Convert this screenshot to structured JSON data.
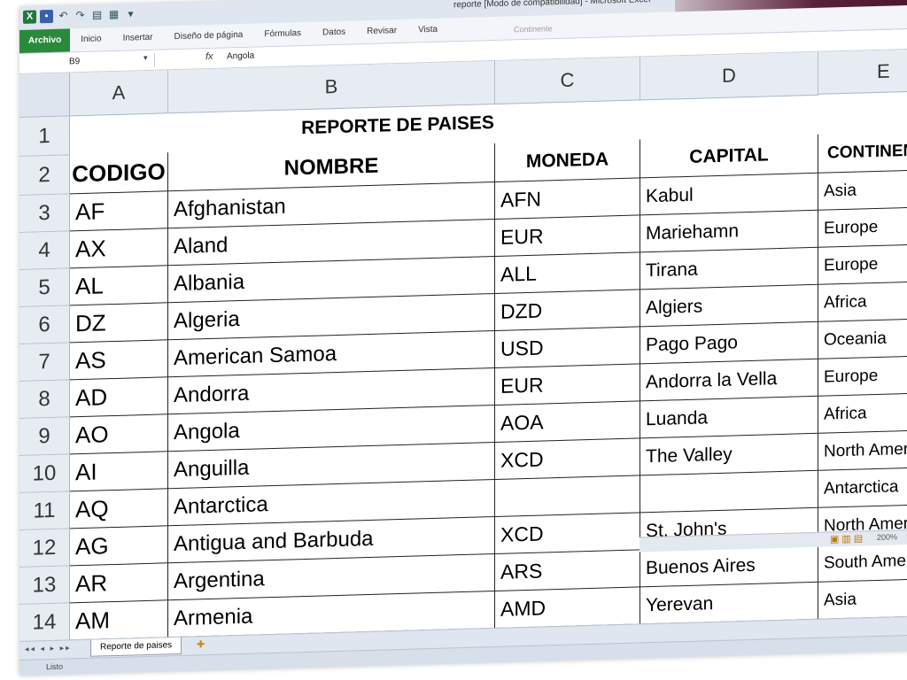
{
  "window": {
    "title": "reporte [Modo de compatibilidad] - Microsoft Excel",
    "contextual_label": "Continente"
  },
  "qat": {
    "logo": "X",
    "undo": "↶",
    "redo": "↷",
    "more": "▾"
  },
  "ribbon": {
    "tabs": [
      "Archivo",
      "Inicio",
      "Insertar",
      "Diseño de página",
      "Fórmulas",
      "Datos",
      "Revisar",
      "Vista"
    ]
  },
  "formula_bar": {
    "name_box": "B9",
    "fx": "fx",
    "value": "Angola"
  },
  "columns": [
    "A",
    "B",
    "C",
    "D",
    "E"
  ],
  "rows": [
    "1",
    "2",
    "3",
    "4",
    "5",
    "6",
    "7",
    "8",
    "9",
    "10",
    "11",
    "12",
    "13",
    "14"
  ],
  "sheet": {
    "title": "REPORTE DE PAISES",
    "headers": {
      "code": "CODIGO",
      "name": "NOMBRE",
      "currency": "MONEDA",
      "capital": "CAPITAL",
      "continent": "CONTINENTE"
    },
    "codes": [
      "AF",
      "AX",
      "AL",
      "DZ",
      "AS",
      "AD",
      "AO",
      "AI",
      "AQ",
      "AG",
      "AR",
      "AM"
    ],
    "names": [
      "Afghanistan",
      "Aland",
      "Albania",
      "Algeria",
      "American Samoa",
      "Andorra",
      "Angola",
      "Anguilla",
      "Antarctica",
      "Antigua and Barbuda",
      "Argentina",
      "Armenia"
    ],
    "currencies": [
      "AFN",
      "EUR",
      "ALL",
      "DZD",
      "USD",
      "EUR",
      "AOA",
      "XCD",
      "",
      "XCD",
      "ARS",
      "AMD"
    ],
    "capitals": [
      "Kabul",
      "Mariehamn",
      "Tirana",
      "Algiers",
      "Pago Pago",
      "Andorra la Vella",
      "Luanda",
      "The Valley",
      "",
      "St. John's",
      "Buenos Aires",
      "Yerevan"
    ],
    "continents": [
      "Asia",
      "Europe",
      "Europe",
      "Africa",
      "Oceania",
      "Europe",
      "Africa",
      "North America",
      "Antarctica",
      "North America",
      "South America",
      "Asia"
    ]
  },
  "sheet_tabs": {
    "nav": "◂◂ ◂ ▸ ▸▸",
    "active": "Reporte de paises"
  },
  "status": {
    "text": "Listo",
    "zoom": "200%"
  },
  "colors": {
    "file_tab": "#2a8a3c",
    "excel_green": "#1f7a3a",
    "header_bg": "#e7ecf3"
  }
}
